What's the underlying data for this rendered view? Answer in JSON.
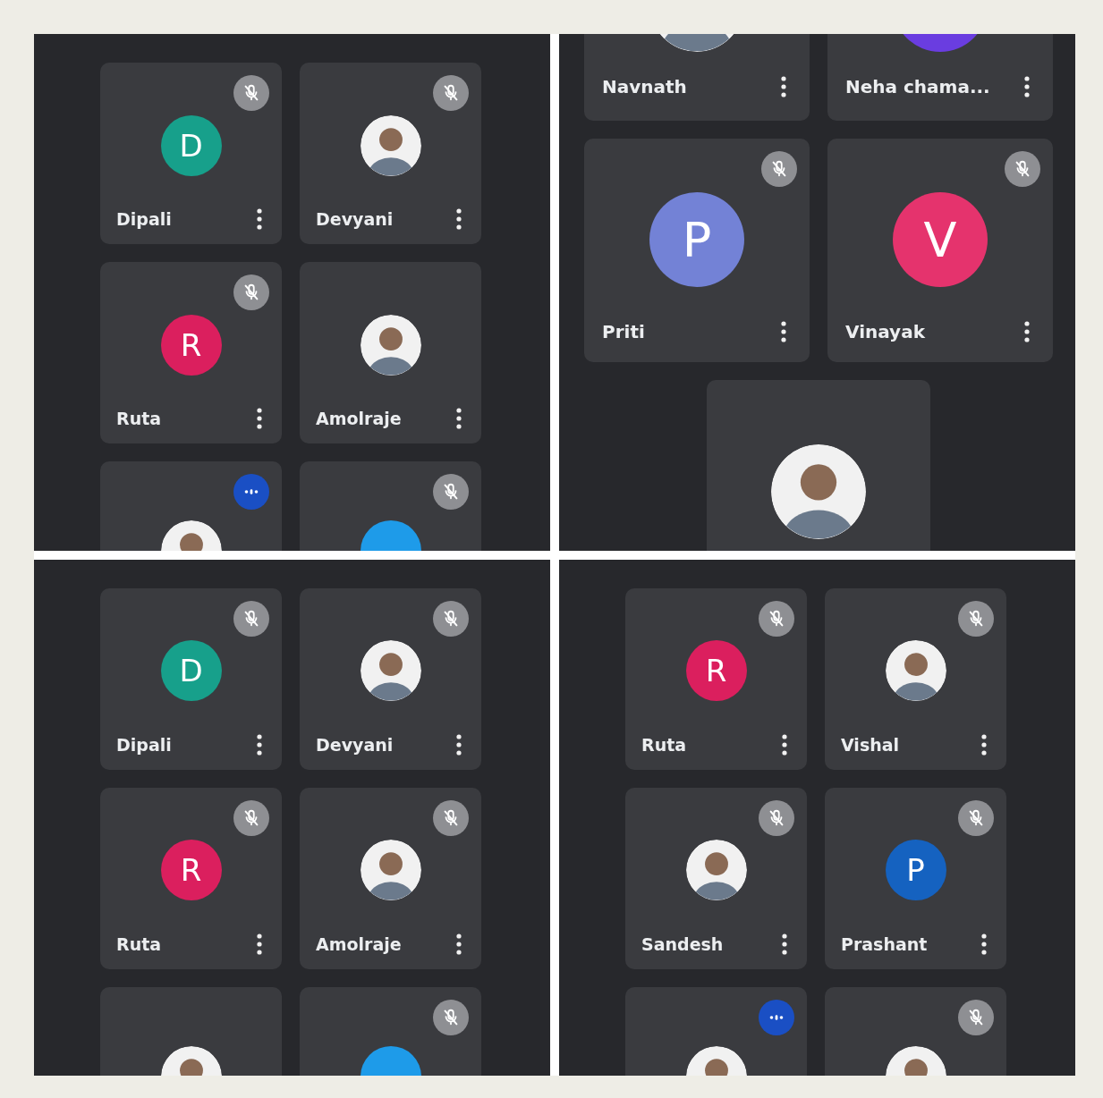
{
  "panels": [
    {
      "kind": "small-tiles",
      "tiles": [
        {
          "kind": "full",
          "name": "Dipali",
          "muted": true,
          "speaking": false,
          "avatar": {
            "kind": "letter",
            "letter": "D",
            "color": "#17a08b"
          }
        },
        {
          "kind": "full",
          "name": "Devyani",
          "muted": true,
          "speaking": false,
          "avatar": {
            "kind": "photo"
          }
        },
        {
          "kind": "full",
          "name": "Ruta",
          "muted": true,
          "speaking": false,
          "avatar": {
            "kind": "letter",
            "letter": "R",
            "color": "#db1f5e"
          }
        },
        {
          "kind": "full",
          "name": "Amolraje",
          "muted": false,
          "speaking": false,
          "avatar": {
            "kind": "photo"
          }
        },
        {
          "kind": "cut",
          "muted": false,
          "speaking": true,
          "avatar": {
            "kind": "photo"
          }
        },
        {
          "kind": "cut",
          "muted": true,
          "speaking": false,
          "avatar": {
            "kind": "letter",
            "color": "#1e9be9"
          }
        }
      ]
    },
    {
      "kind": "large-tiles",
      "tiles": [
        {
          "kind": "name-only",
          "name": "Navnath",
          "muted": false,
          "speaking": false,
          "avatar": {
            "kind": "photo"
          }
        },
        {
          "kind": "name-only",
          "name": "Neha chama...",
          "muted": false,
          "speaking": false,
          "avatar": {
            "kind": "letter",
            "color": "#6a3de0"
          }
        },
        {
          "kind": "full",
          "name": "Priti",
          "muted": true,
          "speaking": false,
          "avatar": {
            "kind": "letter",
            "letter": "P",
            "color": "#7382d6"
          }
        },
        {
          "kind": "full",
          "name": "Vinayak",
          "muted": true,
          "speaking": false,
          "avatar": {
            "kind": "letter",
            "letter": "V",
            "color": "#e5336d"
          }
        },
        {
          "kind": "cut",
          "muted": false,
          "speaking": false,
          "avatar": {
            "kind": "photo"
          }
        }
      ]
    },
    {
      "kind": "small-tiles",
      "tiles": [
        {
          "kind": "full",
          "name": "Dipali",
          "muted": true,
          "speaking": false,
          "avatar": {
            "kind": "letter",
            "letter": "D",
            "color": "#17a08b"
          }
        },
        {
          "kind": "full",
          "name": "Devyani",
          "muted": true,
          "speaking": false,
          "avatar": {
            "kind": "photo"
          }
        },
        {
          "kind": "full",
          "name": "Ruta",
          "muted": true,
          "speaking": false,
          "avatar": {
            "kind": "letter",
            "letter": "R",
            "color": "#db1f5e"
          }
        },
        {
          "kind": "full",
          "name": "Amolraje",
          "muted": true,
          "speaking": false,
          "avatar": {
            "kind": "photo"
          }
        },
        {
          "kind": "cut",
          "muted": false,
          "speaking": false,
          "avatar": {
            "kind": "photo"
          }
        },
        {
          "kind": "cut",
          "muted": true,
          "speaking": false,
          "avatar": {
            "kind": "letter",
            "color": "#1e9be9"
          }
        }
      ]
    },
    {
      "kind": "small-tiles",
      "tiles": [
        {
          "kind": "full",
          "name": "Ruta",
          "muted": true,
          "speaking": false,
          "avatar": {
            "kind": "letter",
            "letter": "R",
            "color": "#db1f5e"
          }
        },
        {
          "kind": "full",
          "name": "Vishal",
          "muted": true,
          "speaking": false,
          "avatar": {
            "kind": "photo"
          }
        },
        {
          "kind": "full",
          "name": "Sandesh",
          "muted": true,
          "speaking": false,
          "avatar": {
            "kind": "photo"
          }
        },
        {
          "kind": "full",
          "name": "Prashant",
          "muted": true,
          "speaking": false,
          "avatar": {
            "kind": "letter",
            "letter": "P",
            "color": "#1562c0"
          }
        },
        {
          "kind": "cut",
          "muted": false,
          "speaking": true,
          "avatar": {
            "kind": "photo"
          }
        },
        {
          "kind": "cut",
          "muted": true,
          "speaking": false,
          "avatar": {
            "kind": "photo"
          }
        }
      ]
    }
  ]
}
